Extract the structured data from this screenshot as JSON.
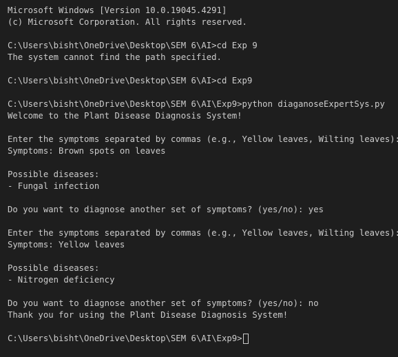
{
  "terminal": {
    "lines": [
      "Microsoft Windows [Version 10.0.19045.4291]",
      "(c) Microsoft Corporation. All rights reserved.",
      "",
      "C:\\Users\\bisht\\OneDrive\\Desktop\\SEM 6\\AI>cd Exp 9",
      "The system cannot find the path specified.",
      "",
      "C:\\Users\\bisht\\OneDrive\\Desktop\\SEM 6\\AI>cd Exp9",
      "",
      "C:\\Users\\bisht\\OneDrive\\Desktop\\SEM 6\\AI\\Exp9>python diaganoseExpertSys.py",
      "Welcome to the Plant Disease Diagnosis System!",
      "",
      "Enter the symptoms separated by commas (e.g., Yellow leaves, Wilting leaves):",
      "Symptoms: Brown spots on leaves",
      "",
      "Possible diseases:",
      "- Fungal infection",
      "",
      "Do you want to diagnose another set of symptoms? (yes/no): yes",
      "",
      "Enter the symptoms separated by commas (e.g., Yellow leaves, Wilting leaves):",
      "Symptoms: Yellow leaves",
      "",
      "Possible diseases:",
      "- Nitrogen deficiency",
      "",
      "Do you want to diagnose another set of symptoms? (yes/no): no",
      "Thank you for using the Plant Disease Diagnosis System!",
      ""
    ],
    "current_prompt": "C:\\Users\\bisht\\OneDrive\\Desktop\\SEM 6\\AI\\Exp9>"
  }
}
